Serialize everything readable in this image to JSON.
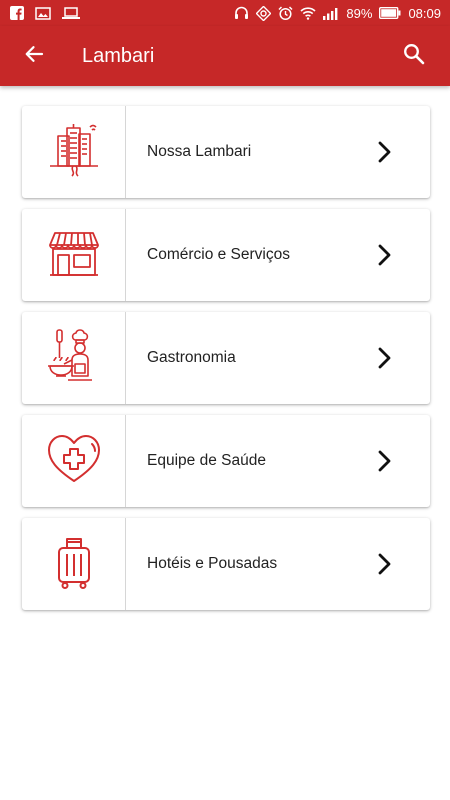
{
  "status_bar": {
    "battery_percent": "89%",
    "time": "08:09",
    "left_icons": [
      "facebook-icon",
      "image-icon",
      "laptop-icon"
    ],
    "right_icons": [
      "headphones-icon",
      "sync-icon",
      "alarm-icon",
      "wifi-icon",
      "signal-icon",
      "battery-icon"
    ]
  },
  "app_bar": {
    "title": "Lambari",
    "back_icon": "arrow-back-icon",
    "search_icon": "search-icon"
  },
  "colors": {
    "primary": "#c62828",
    "icon_red": "#d32f2f",
    "text": "#222222",
    "divider": "#d6d6d6"
  },
  "menu": {
    "items": [
      {
        "label": "Nossa Lambari",
        "icon": "city-buildings-icon"
      },
      {
        "label": "Comércio e Serviços",
        "icon": "storefront-icon"
      },
      {
        "label": "Gastronomia",
        "icon": "chef-icon"
      },
      {
        "label": "Equipe de Saúde",
        "icon": "heart-cross-icon"
      },
      {
        "label": "Hotéis e Pousadas",
        "icon": "luggage-icon"
      }
    ]
  }
}
